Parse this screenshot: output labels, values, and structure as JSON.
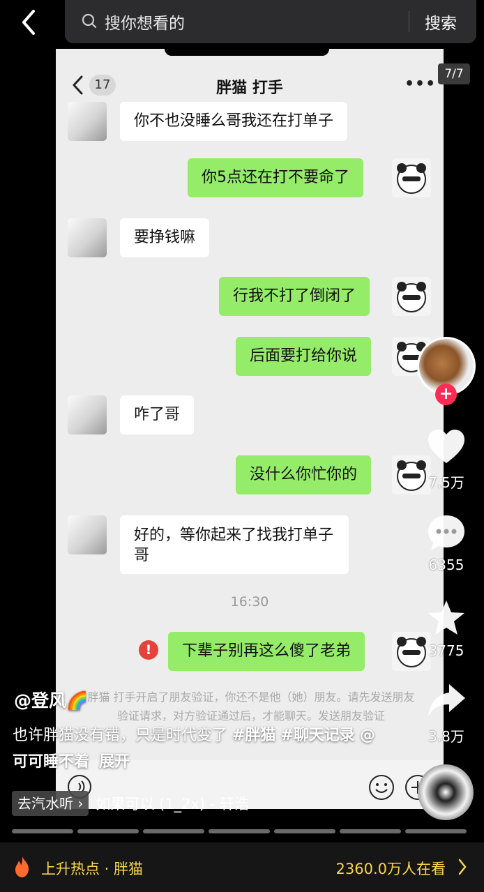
{
  "search": {
    "placeholder": "搜你想看的",
    "button": "搜索"
  },
  "page_indicator": "7/7",
  "chat": {
    "title": "胖猫 打手",
    "unread": "17",
    "more": "•••",
    "messages": [
      {
        "side": "in",
        "text": "你不也没睡么哥我还在打单子"
      },
      {
        "side": "out",
        "text": "你5点还在打不要命了"
      },
      {
        "side": "in",
        "text": "要挣钱嘛"
      },
      {
        "side": "out",
        "text": "行我不打了倒闭了"
      },
      {
        "side": "out",
        "text": "后面要打给你说"
      },
      {
        "side": "in",
        "text": "咋了哥"
      },
      {
        "side": "out",
        "text": "没什么你忙你的"
      },
      {
        "side": "in",
        "text": "好的，等你起来了找我打单子哥"
      },
      {
        "side": "out",
        "text": "下辈子别再这么傻了老弟",
        "failed": true
      }
    ],
    "time": "16:30",
    "error_mark": "!",
    "system_message": "胖猫 打手开启了朋友验证，你还不是他（她）朋友。请先发送朋友验证请求，对方验证通过后，才能聊天。发送朋友验证"
  },
  "rail": {
    "likes": "7.5万",
    "comments": "6355",
    "favorites": "3775",
    "shares": "3.8万",
    "follow": "+"
  },
  "caption": {
    "author": "@登风🌈",
    "text": "也许胖猫没有错，只是时代变了 ",
    "tag1": "#胖猫",
    "tag2": "#聊天记录",
    "mention": "@可可睡不着",
    "expand": "展开"
  },
  "music": {
    "badge": "去汽水听 ›",
    "title": "如果可以 (1_2x) - 轩浩"
  },
  "bottom": {
    "hot_topic": "上升热点 · 胖猫",
    "viewers": "2360.0万人在看"
  },
  "colors": {
    "accent_red": "#fe2c55",
    "wechat_green": "#95ec69",
    "hot_yellow": "#fbd64b"
  },
  "progress": {
    "segments": 7,
    "current": 7
  }
}
